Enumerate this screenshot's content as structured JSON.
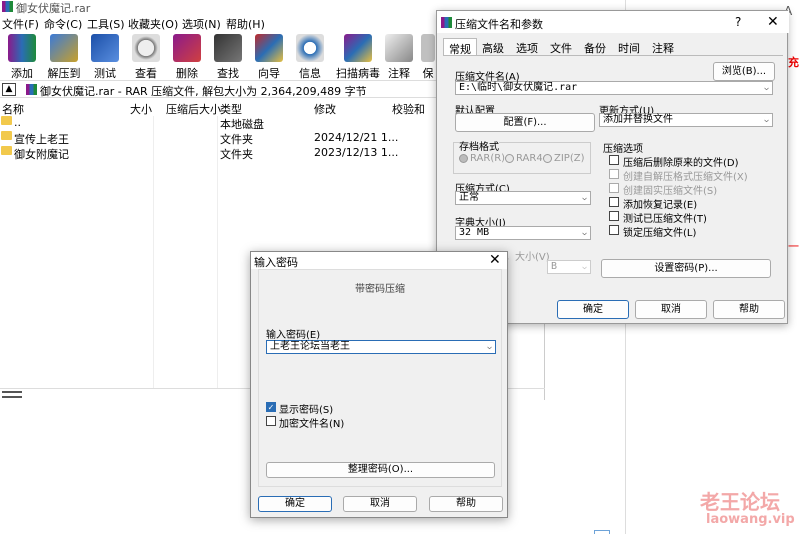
{
  "winrar": {
    "title": "御女伏魔记.rar",
    "menus": [
      "文件(F)",
      "命令(C)",
      "工具(S)",
      "收藏夹(O)",
      "选项(N)",
      "帮助(H)"
    ],
    "toolbar": [
      "添加",
      "解压到",
      "测试",
      "查看",
      "删除",
      "查找",
      "向导",
      "信息",
      "扫描病毒",
      "注释",
      "保"
    ],
    "path": "御女伏魔记.rar - RAR 压缩文件, 解包大小为 2,364,209,489 字节",
    "columns": [
      "名称",
      "大小",
      "压缩后大小",
      "类型",
      "修改",
      "校验和"
    ],
    "rows": [
      {
        "name": "..",
        "type": "本地磁盘",
        "modified": ""
      },
      {
        "name": "宣传上老王",
        "type": "文件夹",
        "modified": "2024/12/21 1..."
      },
      {
        "name": "御女附魔记",
        "type": "文件夹",
        "modified": "2023/12/13 1..."
      }
    ]
  },
  "archive_dialog": {
    "title": "压缩文件名和参数",
    "help": "?",
    "close": "✕",
    "tabs": [
      "常规",
      "高级",
      "选项",
      "文件",
      "备份",
      "时间",
      "注释"
    ],
    "archive_name_label": "压缩文件名(A)",
    "archive_name_value": "E:\\临时\\御女伏魔记.rar",
    "browse": "浏览(B)...",
    "default_profile_label": "默认配置",
    "profile_button": "配置(F)...",
    "update_mode_label": "更新方式(U)",
    "update_mode_value": "添加并替换文件",
    "format_label": "存档格式",
    "formats": [
      "RAR(R)",
      "RAR4",
      "ZIP(Z)"
    ],
    "method_label": "压缩方式(C)",
    "method_value": "正常",
    "dict_label": "字典大小(I)",
    "dict_value": "32 MB",
    "split_label": "切分为分卷，大小(V)",
    "split_unit": "B",
    "options_label": "压缩选项",
    "options": [
      {
        "label": "压缩后删除原来的文件(D)",
        "disabled": false
      },
      {
        "label": "创建自解压格式压缩文件(X)",
        "disabled": true
      },
      {
        "label": "创建固实压缩文件(S)",
        "disabled": true
      },
      {
        "label": "添加恢复记录(E)",
        "disabled": false
      },
      {
        "label": "测试已压缩文件(T)",
        "disabled": false
      },
      {
        "label": "锁定压缩文件(L)",
        "disabled": false
      }
    ],
    "set_password": "设置密码(P)...",
    "ok": "确定",
    "cancel": "取消",
    "help_btn": "帮助"
  },
  "password_dialog": {
    "title": "输入密码",
    "close": "✕",
    "subtitle": "带密码压缩",
    "input_label": "输入密码(E)",
    "password_value": "上老王论坛当老王",
    "show_password": "显示密码(S)",
    "encrypt_names": "加密文件名(N)",
    "organize": "整理密码(O)...",
    "ok": "确定",
    "cancel": "取消",
    "help": "帮助"
  },
  "background": {
    "minimize": "−",
    "font_icon": "A",
    "red_text_1": "充",
    "red_text_2": "一",
    "watermark_1": "老王论坛",
    "watermark_2": "laowang.vip"
  }
}
